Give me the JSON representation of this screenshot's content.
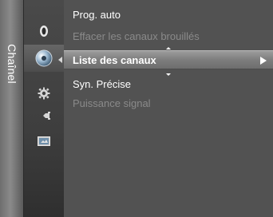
{
  "sidebar": {
    "label": "Chaînel"
  },
  "icons": [
    {
      "name": "picture-icon",
      "active": false
    },
    {
      "name": "sound-icon",
      "active": false
    },
    {
      "name": "channel-icon",
      "active": true
    },
    {
      "name": "setup-icon",
      "active": false
    },
    {
      "name": "input-icon",
      "active": false
    },
    {
      "name": "application-icon",
      "active": false
    }
  ],
  "menu": {
    "items": [
      {
        "label": "Prog. auto",
        "state": "enabled"
      },
      {
        "label": "Effacer les canaux brouillés",
        "state": "disabled"
      },
      {
        "label": "Liste des canaux",
        "state": "selected"
      },
      {
        "label": "Syn. Précise",
        "state": "enabled"
      },
      {
        "label": "Puissance signal",
        "state": "disabled"
      }
    ]
  },
  "colors": {
    "menu_bg": "#525252",
    "selected_bg": "#8a8a8a",
    "text_enabled": "#ffffff",
    "text_disabled": "#8a8a8a"
  }
}
